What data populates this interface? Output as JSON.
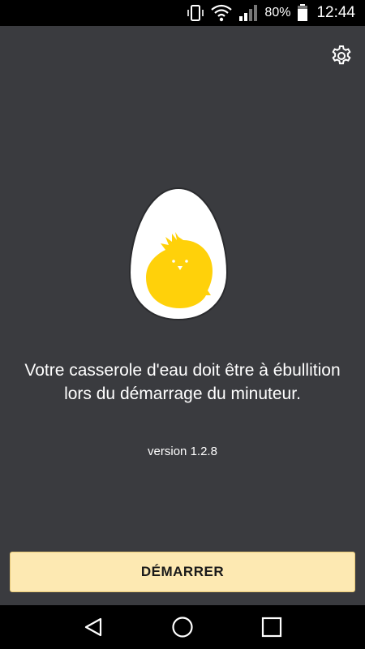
{
  "status_bar": {
    "battery_percent": "80%",
    "time": "12:44",
    "icons": [
      "vibrate-icon",
      "wifi-icon",
      "signal-icon",
      "battery-icon"
    ]
  },
  "main": {
    "settings_icon": "gear-icon",
    "illustration": "egg-chick-icon",
    "message_line1": "Votre casserole d'eau doit être à ébullition",
    "message_line2": "lors du démarrage du minuteur.",
    "version": "version 1.2.8",
    "start_label": "DÉMARRER"
  },
  "colors": {
    "background": "#3a3b3f",
    "button_bg": "#fde9b2",
    "yolk": "#ffd10a",
    "egg_white": "#ffffff"
  },
  "nav_bar": {
    "icons": [
      "back-icon",
      "home-icon",
      "recents-icon"
    ]
  }
}
